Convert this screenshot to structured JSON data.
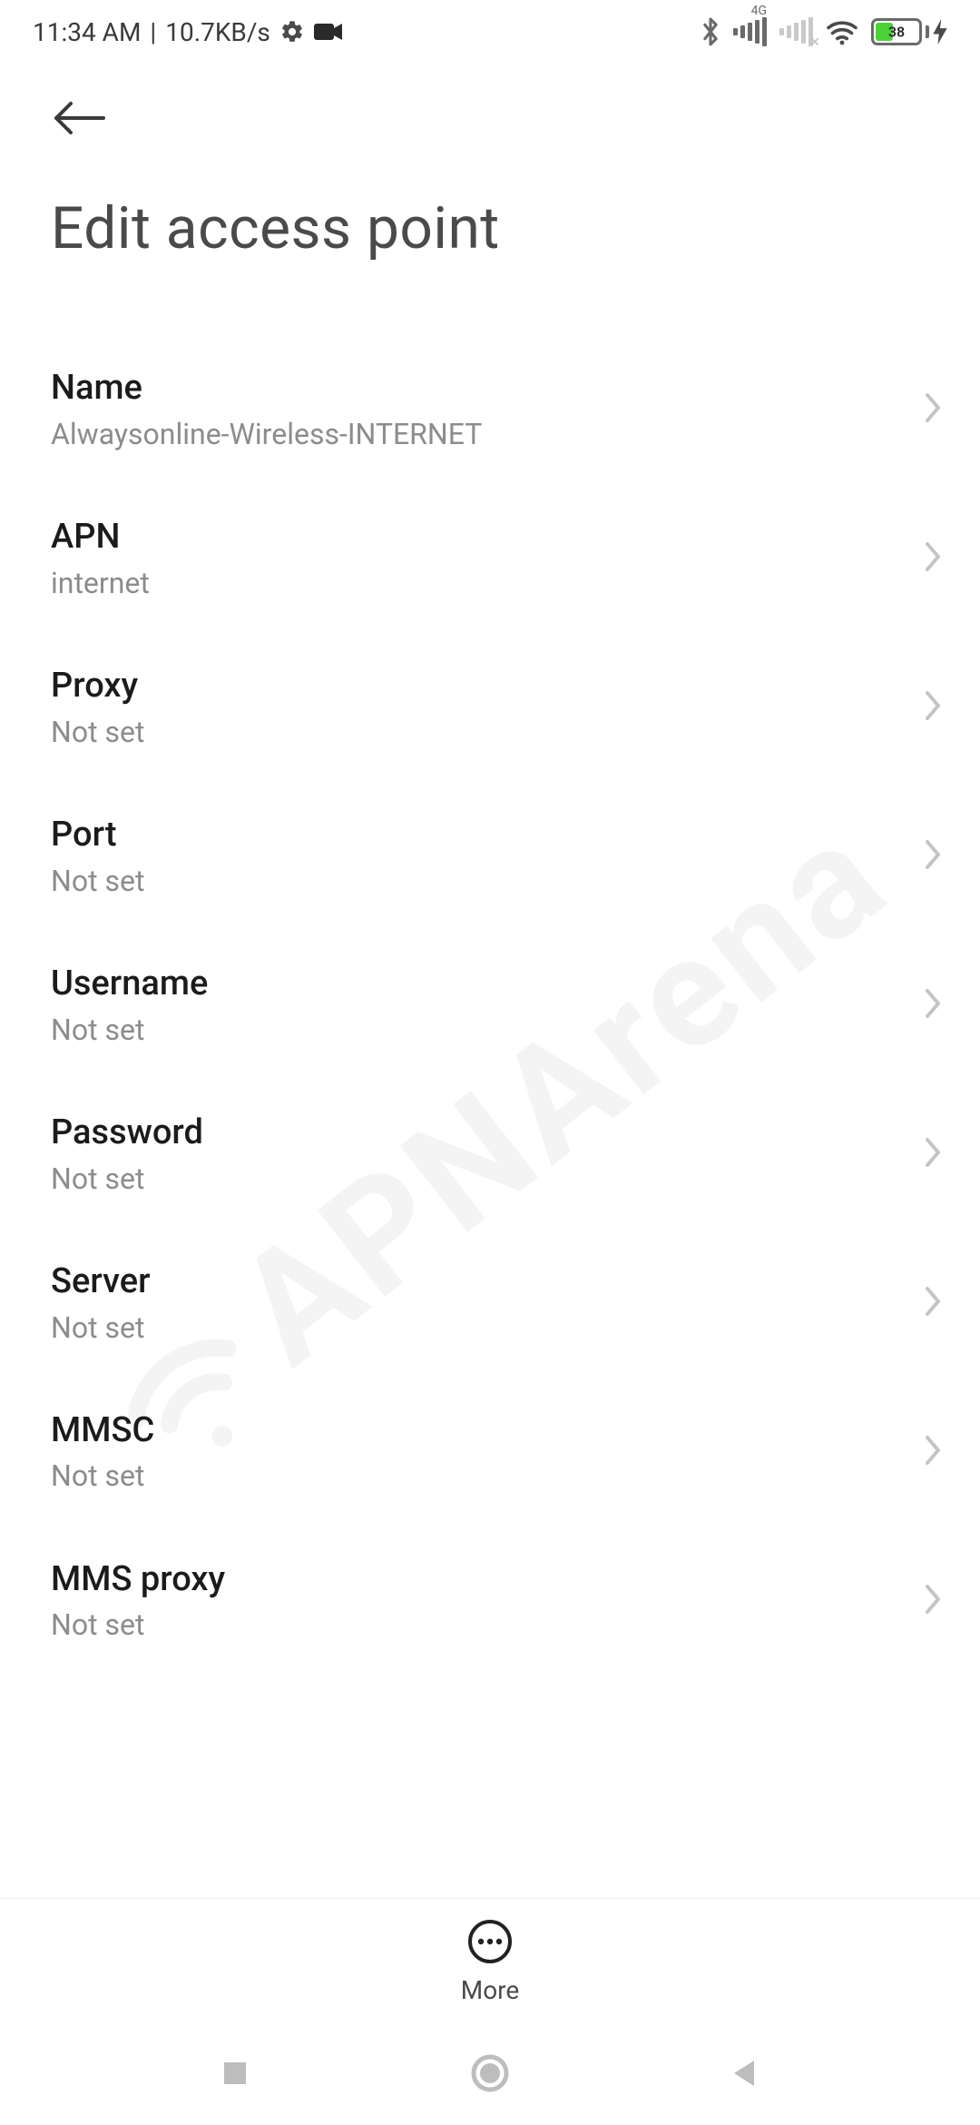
{
  "status": {
    "time": "11:34 AM",
    "sep": "|",
    "net_speed": "10.7KB/s",
    "sim1_label": "4G",
    "battery_pct": "38"
  },
  "page": {
    "title": "Edit access point"
  },
  "rows": [
    {
      "title": "Name",
      "value": "Alwaysonline-Wireless-INTERNET"
    },
    {
      "title": "APN",
      "value": "internet"
    },
    {
      "title": "Proxy",
      "value": "Not set"
    },
    {
      "title": "Port",
      "value": "Not set"
    },
    {
      "title": "Username",
      "value": "Not set"
    },
    {
      "title": "Password",
      "value": "Not set"
    },
    {
      "title": "Server",
      "value": "Not set"
    },
    {
      "title": "MMSC",
      "value": "Not set"
    },
    {
      "title": "MMS proxy",
      "value": "Not set"
    }
  ],
  "bottom": {
    "more": "More"
  },
  "watermark": "APNArena"
}
